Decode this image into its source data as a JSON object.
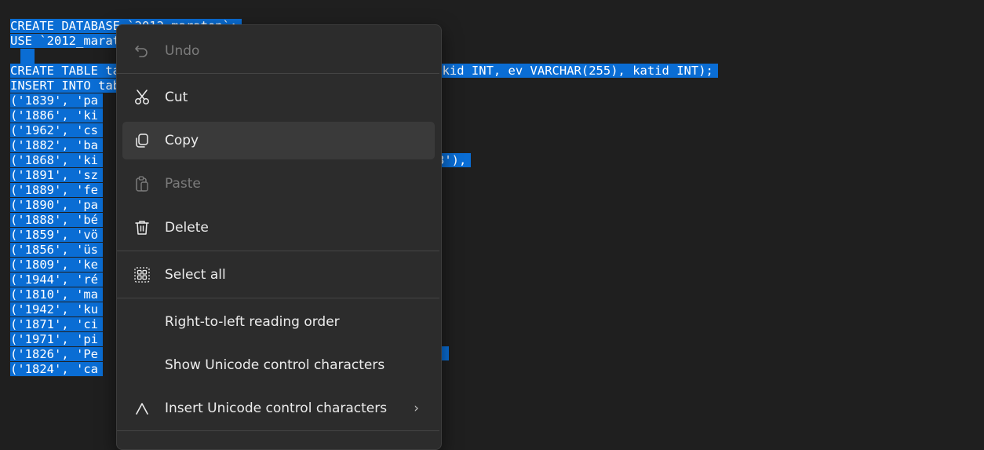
{
  "editor": {
    "line1": "CREATE DATABASE `2012_maraton`;",
    "line2": "USE `2012_maraton`;",
    "line4": "CREATE TABLE tabla (id VARCHAR(255), nev VARCHAR(255), ertekid INT, ev VARCHAR(255), katid INT);",
    "line5": "INSERT INTO tabla VALUES",
    "rows": [
      "('1839', 'pa",
      "('1886', 'ki",
      "('1962', 'cs",
      "('1882', 'ba",
      "('1868', 'ki",
      "('1891', 'sz",
      "('1889', 'fe",
      "('1890', 'pa",
      "('1888', 'bé",
      "('1859', 'vö",
      "('1856', 'üs",
      "('1809', 'ke",
      "('1944', 'ré",
      "('1810', 'ma",
      "('1942', 'ku",
      "('1871', 'ci",
      "('1971', 'pi",
      "('1826', 'Pe",
      "('1824', 'ca"
    ],
    "visible_right_fragment_row3": "3'),",
    "visible_right_fragment_row14": ","
  },
  "context_menu": {
    "undo": "Undo",
    "cut": "Cut",
    "copy": "Copy",
    "paste": "Paste",
    "delete": "Delete",
    "select_all": "Select all",
    "rtl": "Right-to-left reading order",
    "show_unicode": "Show Unicode control characters",
    "insert_unicode": "Insert Unicode control characters",
    "submenu_chevron": "›"
  },
  "colors": {
    "selection": "#0a6dd4",
    "menu_bg": "#2c2c2c",
    "editor_bg": "#1f1f1f"
  },
  "icons": [
    "undo-icon",
    "scissors-icon",
    "copy-icon",
    "paste-icon",
    "trash-icon",
    "select-all-icon",
    "unicode-insert-icon"
  ]
}
